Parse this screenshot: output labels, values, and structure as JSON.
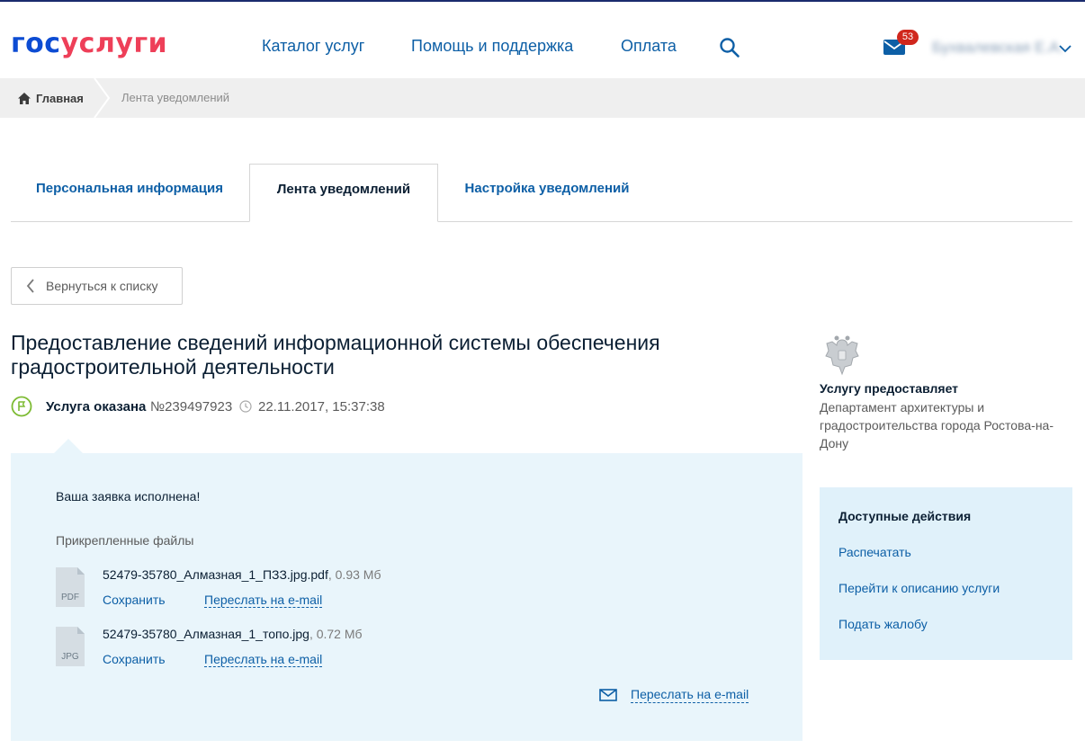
{
  "header": {
    "logo_part1": "гос",
    "logo_part2": "услуги",
    "nav": [
      "Каталог услуг",
      "Помощь и поддержка",
      "Оплата"
    ],
    "mail_count": "53",
    "user_name": "Бухвалевская Е.А."
  },
  "breadcrumb": {
    "home": "Главная",
    "current": "Лента уведомлений"
  },
  "tabs": [
    {
      "label": "Персональная информация",
      "active": false
    },
    {
      "label": "Лента уведомлений",
      "active": true
    },
    {
      "label": "Настройка уведомлений",
      "active": false
    }
  ],
  "back_button": "Вернуться к списку",
  "title": "Предоставление сведений информационной системы обеспечения градостроительной деятельности",
  "status": {
    "label": "Услуга оказана",
    "number": "№239497923",
    "datetime": "22.11.2017, 15:37:38"
  },
  "message": {
    "text": "Ваша заявка исполнена!",
    "files_title": "Прикрепленные файлы",
    "files": [
      {
        "type": "PDF",
        "name": "52479-35780_Алмазная_1_ПЗЗ.jpg.pdf",
        "size": ", 0.93 Мб",
        "save": "Сохранить",
        "forward": "Переслать на e-mail"
      },
      {
        "type": "JPG",
        "name": "52479-35780_Алмазная_1_топо.jpg",
        "size": ", 0.72 Мб",
        "save": "Сохранить",
        "forward": "Переслать на e-mail"
      }
    ],
    "forward_all": "Переслать на e-mail"
  },
  "provider": {
    "title": "Услугу предоставляет",
    "name": "Департамент архитектуры и градостроительства города Ростова-на-Дону"
  },
  "actions": {
    "title": "Доступные действия",
    "items": [
      "Распечатать",
      "Перейти к описанию услуги",
      "Подать жалобу"
    ]
  },
  "colors": {
    "brand_blue": "#0d4cd3",
    "brand_red": "#ee3f58",
    "link": "#0d5fa6",
    "panel_bg": "#e9f5fb",
    "badge": "#d0271d",
    "status_green": "#7dbb33"
  }
}
